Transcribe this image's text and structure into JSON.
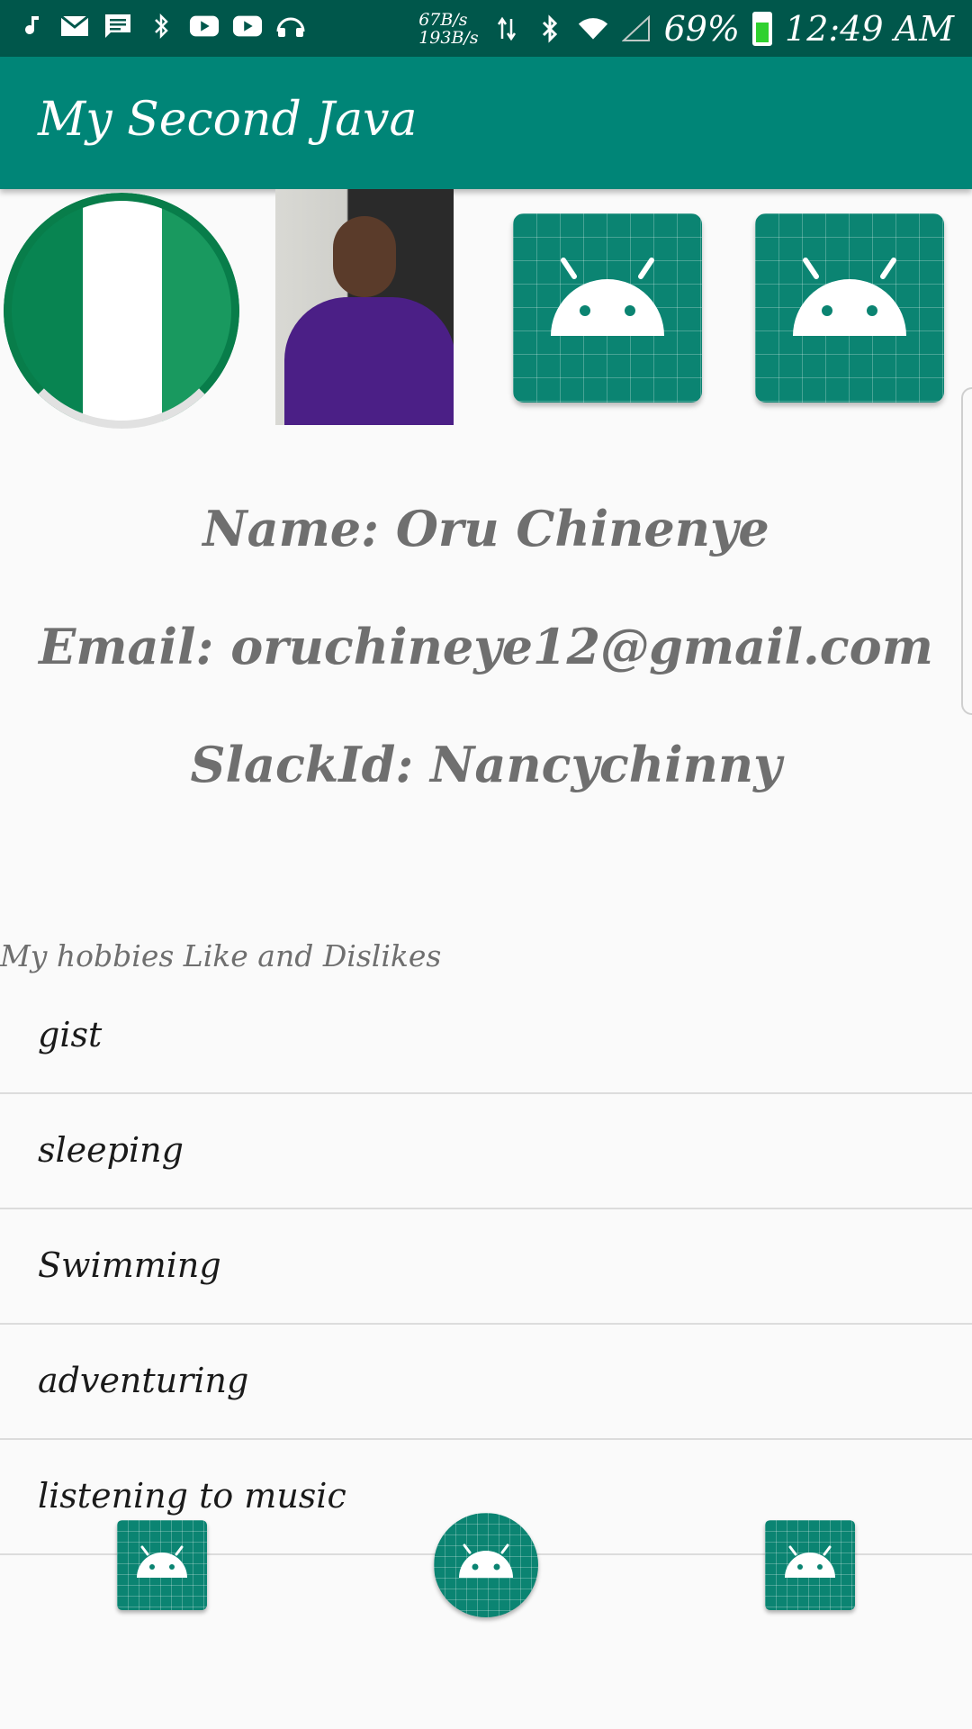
{
  "status_bar": {
    "net_speed_up": "67B/s",
    "net_speed_down": "193B/s",
    "battery_percent": "69%",
    "time": "12:49 AM",
    "icons": [
      "music-note-icon",
      "mail-icon",
      "message-icon",
      "bluetooth-icon",
      "youtube-icon",
      "youtube-icon",
      "headset-icon",
      "data-arrows-icon",
      "bluetooth-icon",
      "wifi-icon",
      "signal-icon",
      "battery-icon"
    ]
  },
  "app_bar": {
    "title": "My Second Java"
  },
  "images": {
    "flag": "nigeria-flag",
    "photo": "profile-photo",
    "launcher_icons": [
      "android-launcher-icon",
      "android-launcher-icon"
    ]
  },
  "profile": {
    "name": "Name: Oru Chinenye",
    "email": "Email: oruchineye12@gmail.com",
    "slack": "SlackId: Nancychinny"
  },
  "hobbies": {
    "heading": "My hobbies Like and Dislikes",
    "items": [
      "gist",
      "sleeping",
      "Swimming",
      "adventuring",
      "listening to music"
    ]
  },
  "bottom_bar": {
    "icons": [
      "android-square-icon",
      "android-round-icon",
      "android-square-icon"
    ]
  },
  "colors": {
    "status_bar": "#00574b",
    "app_bar": "#008577",
    "accent_teal": "#0b8472",
    "text_gray": "#6f6f6f"
  }
}
